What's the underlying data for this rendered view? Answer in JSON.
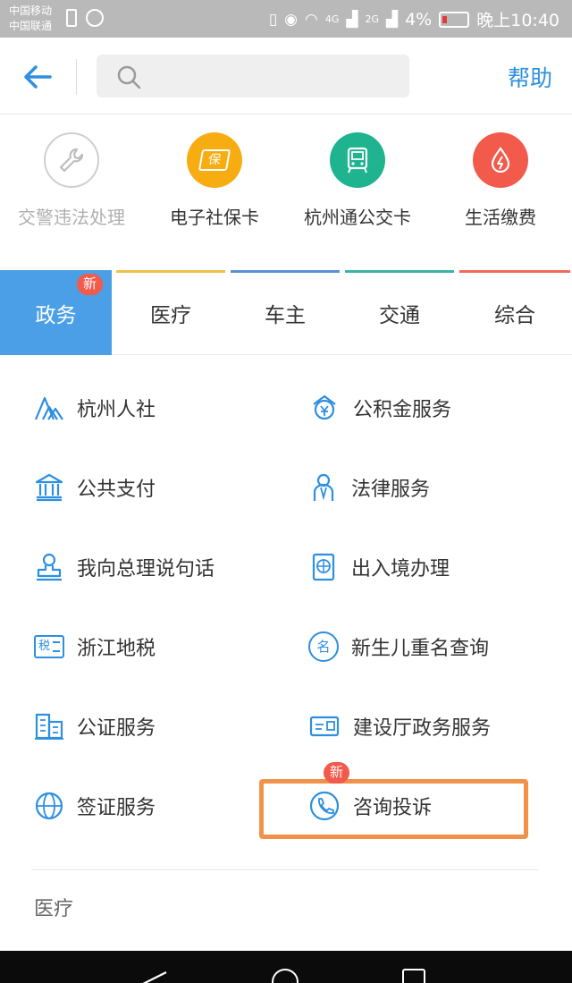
{
  "status_bar": {
    "carrier_1": "中国移动",
    "carrier_2": "中国联通",
    "net_1": "4G",
    "net_2": "2G",
    "battery": "4%",
    "time": "晚上10:40"
  },
  "header": {
    "search_placeholder": "",
    "help_label": "帮助"
  },
  "quick_services": [
    {
      "label": "交警违法处理",
      "icon": "wrench-icon",
      "color": "#ffffff",
      "disabled": true
    },
    {
      "label": "电子社保卡",
      "icon": "insurance-card-icon",
      "icon_text": "保",
      "color": "#f7ac12",
      "disabled": false
    },
    {
      "label": "杭州通公交卡",
      "icon": "bus-card-icon",
      "color": "#1fb38f",
      "disabled": false
    },
    {
      "label": "生活缴费",
      "icon": "utility-drop-icon",
      "color": "#f25a4b",
      "disabled": false
    }
  ],
  "tabs": [
    {
      "label": "政务",
      "active": true,
      "badge": "新",
      "line_color": "#4a9fe6"
    },
    {
      "label": "医疗",
      "active": false,
      "line_color": "#f0c04a"
    },
    {
      "label": "车主",
      "active": false,
      "line_color": "#5b8fd6"
    },
    {
      "label": "交通",
      "active": false,
      "line_color": "#3bb3a6"
    },
    {
      "label": "综合",
      "active": false,
      "line_color": "#f06a5a"
    }
  ],
  "services": [
    {
      "label": "杭州人社",
      "icon": "mountain-icon"
    },
    {
      "label": "公积金服务",
      "icon": "housing-fund-icon"
    },
    {
      "label": "公共支付",
      "icon": "bank-icon"
    },
    {
      "label": "法律服务",
      "icon": "lawyer-icon"
    },
    {
      "label": "我向总理说句话",
      "icon": "stamp-icon"
    },
    {
      "label": "出入境办理",
      "icon": "passport-icon"
    },
    {
      "label": "浙江地税",
      "icon": "tax-icon",
      "icon_text": "税"
    },
    {
      "label": "新生儿重名查询",
      "icon": "name-search-icon",
      "icon_text": "名"
    },
    {
      "label": "公证服务",
      "icon": "notary-building-icon"
    },
    {
      "label": "建设厅政务服务",
      "icon": "id-card-icon"
    },
    {
      "label": "签证服务",
      "icon": "globe-icon"
    },
    {
      "label": "咨询投诉",
      "icon": "phone-icon",
      "badge": "新",
      "highlighted": true
    }
  ],
  "section_title": "医疗",
  "colors": {
    "accent": "#2d8fe0",
    "tab_active": "#4a9fe6",
    "badge": "#f25a4b",
    "highlight": "#f0924a"
  }
}
